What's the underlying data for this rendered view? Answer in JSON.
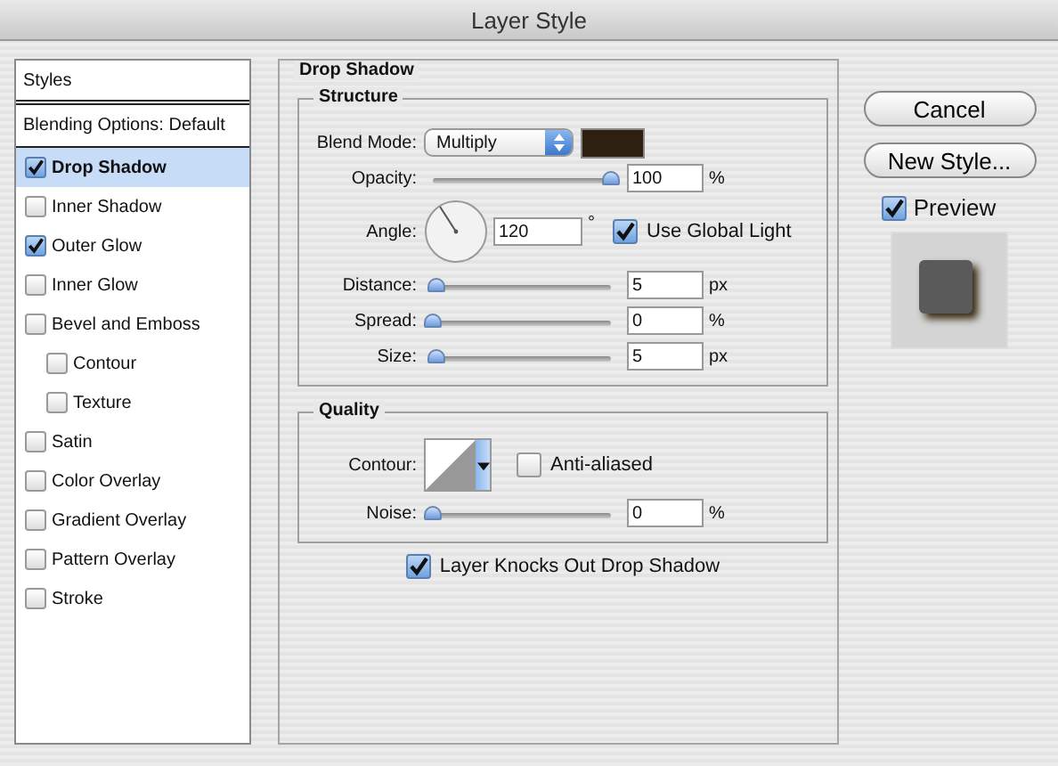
{
  "window": {
    "title": "Layer Style"
  },
  "styles_panel": {
    "header": "Styles",
    "blending_options": "Blending Options: Default",
    "items": [
      {
        "label": "Drop Shadow",
        "checked": true,
        "selected": true
      },
      {
        "label": "Inner Shadow",
        "checked": false,
        "selected": false
      },
      {
        "label": "Outer Glow",
        "checked": true,
        "selected": false
      },
      {
        "label": "Inner Glow",
        "checked": false,
        "selected": false
      },
      {
        "label": "Bevel and Emboss",
        "checked": false,
        "selected": false,
        "children": [
          {
            "label": "Contour",
            "checked": false,
            "selected": false
          },
          {
            "label": "Texture",
            "checked": false,
            "selected": false
          }
        ]
      },
      {
        "label": "Satin",
        "checked": false,
        "selected": false
      },
      {
        "label": "Color Overlay",
        "checked": false,
        "selected": false
      },
      {
        "label": "Gradient Overlay",
        "checked": false,
        "selected": false
      },
      {
        "label": "Pattern Overlay",
        "checked": false,
        "selected": false
      },
      {
        "label": "Stroke",
        "checked": false,
        "selected": false
      }
    ]
  },
  "drop_shadow": {
    "title": "Drop Shadow",
    "structure": {
      "title": "Structure",
      "blend_mode": {
        "label": "Blend Mode:",
        "value": "Multiply",
        "color": "#2e2010"
      },
      "opacity": {
        "label": "Opacity:",
        "level": 1.0,
        "value": "100",
        "unit": "%"
      },
      "angle": {
        "label": "Angle:",
        "value": "120",
        "unit": "°",
        "global_light": {
          "label": "Use Global Light",
          "checked": true
        }
      },
      "sliders": [
        {
          "label": "Distance:",
          "level": 0.02,
          "value": "5",
          "unit": "px"
        },
        {
          "label": "Spread:",
          "level": 0.0,
          "value": "0",
          "unit": "%"
        },
        {
          "label": "Size:",
          "level": 0.02,
          "value": "5",
          "unit": "px"
        }
      ]
    },
    "quality": {
      "title": "Quality",
      "contour_label": "Contour:",
      "anti_aliased": {
        "label": "Anti-aliased",
        "checked": false
      },
      "noise": {
        "label": "Noise:",
        "level": 0.0,
        "value": "0",
        "unit": "%"
      }
    },
    "knockout": {
      "label": "Layer Knocks Out Drop Shadow",
      "checked": true
    }
  },
  "buttons": [
    {
      "label": "Cancel"
    },
    {
      "label": "New Style..."
    }
  ],
  "preview": {
    "label": "Preview",
    "checked": true
  }
}
